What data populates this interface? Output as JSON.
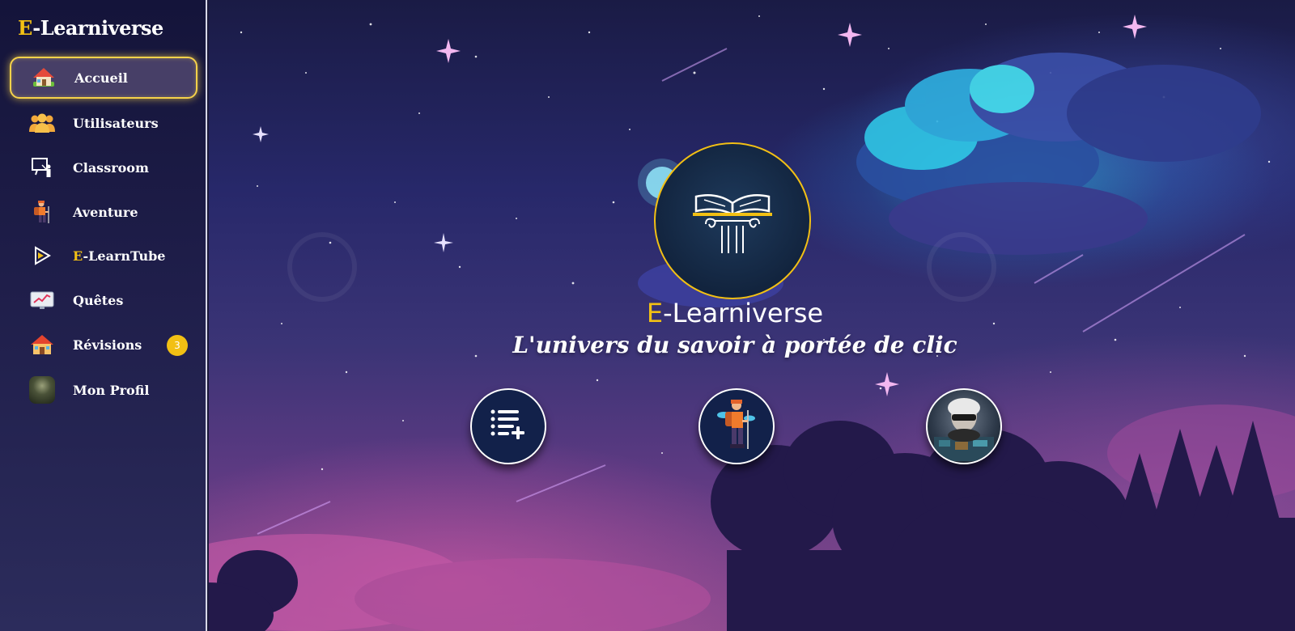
{
  "brand": {
    "prefix": "E",
    "rest": "-Learniverse"
  },
  "sidebar": {
    "items": [
      {
        "label": "Accueil",
        "icon": "home-icon",
        "active": true
      },
      {
        "label": "Utilisateurs",
        "icon": "users-icon"
      },
      {
        "label": "Classroom",
        "icon": "classroom-icon"
      },
      {
        "label": "Aventure",
        "icon": "hiker-icon"
      },
      {
        "label_prefix": "E",
        "label": "-LearnTube",
        "icon": "play-icon"
      },
      {
        "label": "Quêtes",
        "icon": "chart-icon"
      },
      {
        "label": "Révisions",
        "icon": "house-icon",
        "badge": "3"
      },
      {
        "label": "Mon Profil",
        "icon": "avatar"
      }
    ]
  },
  "hero": {
    "title_prefix": "E",
    "title_rest": "-Learniverse",
    "subtitle": "L'univers du savoir à portée de clic",
    "logo_icon": "book-pillar-icon"
  },
  "actions": [
    {
      "icon": "list-add-icon"
    },
    {
      "icon": "hiker-icon"
    },
    {
      "icon": "avatar"
    }
  ],
  "colors": {
    "accent": "#f2c014",
    "sidebar": "#1f1e4a",
    "button_bg": "#12214a"
  }
}
